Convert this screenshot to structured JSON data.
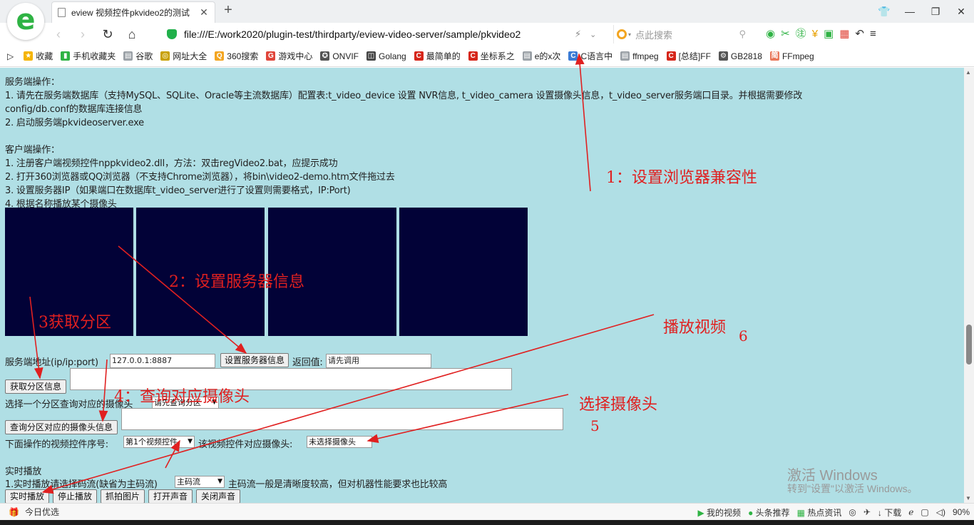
{
  "browser": {
    "tab_title": "eview 视频控件pkvideo2的测试",
    "url": "file:///E:/work2020/plugin-test/thirdparty/eview-video-server/sample/pkvideo2",
    "search_placeholder": "点此搜索",
    "zoom": "90%",
    "bookmarks": [
      {
        "label": "收藏",
        "icon": "star-icon",
        "color": "#f5b400"
      },
      {
        "label": "手机收藏夹",
        "icon": "phone-icon",
        "color": "#2fb344"
      },
      {
        "label": "谷歌",
        "icon": "doc-icon",
        "color": "#9aa0a6"
      },
      {
        "label": "网址大全",
        "icon": "globe-icon",
        "color": "#c8a000"
      },
      {
        "label": "360搜索",
        "icon": "search-icon",
        "color": "#f3a521"
      },
      {
        "label": "游戏中心",
        "icon": "game-icon",
        "color": "#e0453a"
      },
      {
        "label": "ONVIF",
        "icon": "onvif-icon",
        "color": "#555555"
      },
      {
        "label": "Golang",
        "icon": "book-icon",
        "color": "#444444"
      },
      {
        "label": "最简单的",
        "icon": "csdn-icon",
        "color": "#d6261a"
      },
      {
        "label": "坐标系之",
        "icon": "csdn-icon",
        "color": "#d6261a"
      },
      {
        "label": "e的x次",
        "icon": "doc-icon",
        "color": "#9aa0a6"
      },
      {
        "label": "C语言中",
        "icon": "c-icon",
        "color": "#3a7bd5"
      },
      {
        "label": "ffmpeg",
        "icon": "doc-icon",
        "color": "#9aa0a6"
      },
      {
        "label": "[总结]FF",
        "icon": "csdn-icon",
        "color": "#d6261a"
      },
      {
        "label": "GB2818",
        "icon": "gb-icon",
        "color": "#555555"
      },
      {
        "label": "FFmpeg",
        "icon": "jianshu-icon",
        "color": "#e9775a"
      }
    ]
  },
  "page": {
    "server_ops_title": "服务端操作：",
    "server_step1_line1": "1. 请先在服务端数据库（支持MySQL、SQLite、Oracle等主流数据库）配置表:t_video_device 设置 NVR信息, t_video_camera 设置摄像头信息，t_video_server服务端口目录。并根据需要修改",
    "server_step1_line2": "config/db.conf的数据库连接信息",
    "server_step2": "2. 启动服务端pkvideoserver.exe",
    "client_ops_title": "客户端操作：",
    "client_step1": "1. 注册客户端视频控件nppkvideo2.dll，方法：双击regVideo2.bat，应提示成功",
    "client_step2": "2. 打开360浏览器或QQ浏览器（不支持Chrome浏览器），将bin\\video2-demo.htm文件拖过去",
    "client_step3": "3. 设置服务器IP（如果端口在数据库t_video_server进行了设置则需要格式，IP:Port)",
    "client_step4": "4. 根据名称播放某个摄像头",
    "server_addr_label": "服务端地址(ip/ip:port)",
    "server_addr_value": "127.0.0.1:8887",
    "set_server_button": "设置服务器信息",
    "return_label": "返回值:",
    "return_value": "请先调用",
    "get_partition_button": "获取分区信息",
    "choose_partition_label": "选择一个分区查询对应的摄像头",
    "partition_select": "请先查询分区",
    "query_camera_button": "查询分区对应的摄像头信息",
    "control_index_label": "下面操作的视频控件序号:",
    "control_index_select": "第1个视频控件",
    "control_camera_label": "该视频控件对应摄像头:",
    "control_camera_select": "未选择摄像头",
    "realtime_title": "实时播放",
    "stream_label": "1.实时播放请选择码流(缺省为主码流)",
    "stream_select": "主码流",
    "stream_note": "主码流一般是清晰度较高，但对机器性能要求也比较高",
    "buttons": [
      "实时播放",
      "停止播放",
      "抓拍图片",
      "打开声音",
      "关闭声音"
    ]
  },
  "annotations": {
    "note1": "1：设置浏览器兼容性",
    "note2": "2：设置服务器信息",
    "note3": "3获取分区",
    "note4": "4：查询对应摄像头",
    "note5_text": "选择摄像头",
    "note5_num": "5",
    "note6_text": "播放视频",
    "note6_num": "6",
    "arrow_color": "#e02020"
  },
  "watermark": {
    "line1": "激活 Windows",
    "line2": "转到\"设置\"以激活 Windows。"
  },
  "statusbar": {
    "left": "今日优选",
    "items": [
      "我的视频",
      "头条推荐",
      "热点资讯",
      "下载"
    ]
  }
}
